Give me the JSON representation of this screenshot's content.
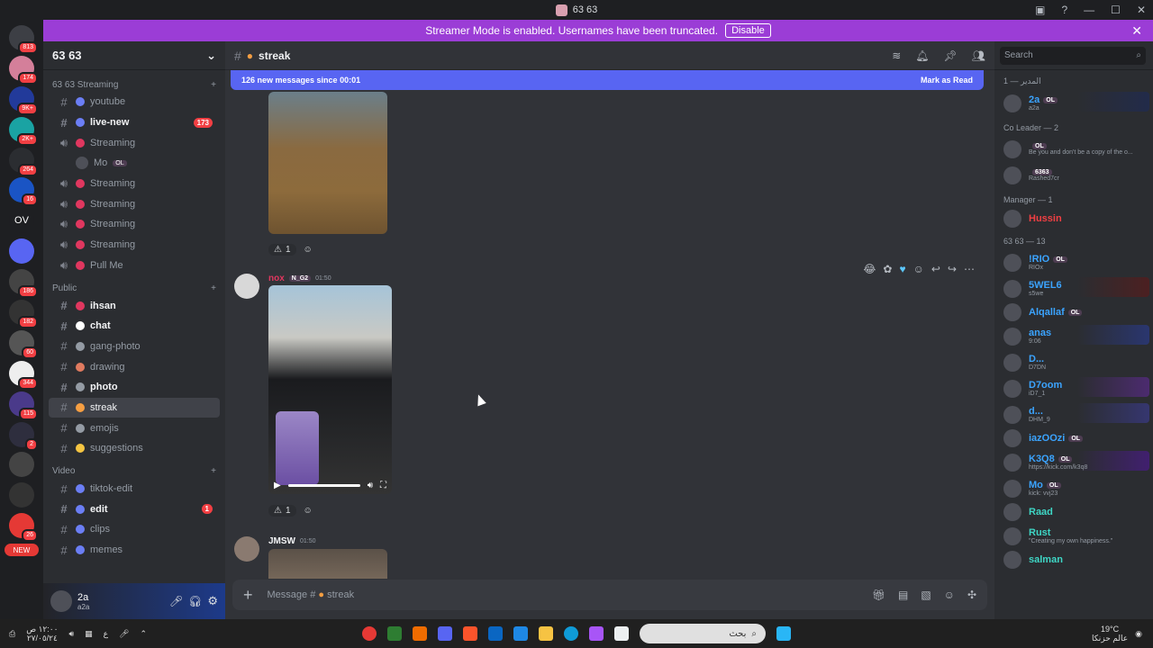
{
  "window": {
    "title": "63 63"
  },
  "banner": {
    "text": "Streamer Mode is enabled. Usernames have been truncated.",
    "disable_label": "Disable"
  },
  "servers": [
    {
      "label": "",
      "badge": "813"
    },
    {
      "label": "",
      "badge": "174"
    },
    {
      "label": "",
      "badge": "9K+"
    },
    {
      "label": "",
      "badge": "2K+"
    },
    {
      "label": "",
      "badge": "264"
    },
    {
      "label": "",
      "badge": "16"
    },
    {
      "label": "OV",
      "badge": ""
    },
    {
      "label": "",
      "badge": ""
    },
    {
      "label": "",
      "badge": "186"
    },
    {
      "label": "",
      "badge": "182"
    },
    {
      "label": "",
      "badge": "60"
    },
    {
      "label": "",
      "badge": "344"
    },
    {
      "label": "",
      "badge": "115"
    },
    {
      "label": "",
      "badge": "2"
    },
    {
      "label": "",
      "badge": ""
    },
    {
      "label": "",
      "badge": ""
    },
    {
      "label": "",
      "badge": "26"
    },
    {
      "label": "NEW",
      "badge": ""
    }
  ],
  "sidebar": {
    "guild_name": "63 63",
    "categories": [
      {
        "name": "63 63 Streaming"
      },
      {
        "name": "Public"
      },
      {
        "name": "Video"
      }
    ],
    "streaming_channels": [
      {
        "name": "youtube",
        "kind": "text",
        "unread": false,
        "count": ""
      },
      {
        "name": "live-new",
        "kind": "text",
        "unread": true,
        "count": "173"
      },
      {
        "name": "Streaming",
        "kind": "voice",
        "unread": false,
        "count": ""
      },
      {
        "name": "Streaming",
        "kind": "voice",
        "unread": false,
        "count": ""
      },
      {
        "name": "Streaming",
        "kind": "voice",
        "unread": false,
        "count": ""
      },
      {
        "name": "Streaming",
        "kind": "voice",
        "unread": false,
        "count": ""
      },
      {
        "name": "Streaming",
        "kind": "voice",
        "unread": false,
        "count": ""
      },
      {
        "name": "Pull Me",
        "kind": "voice",
        "unread": false,
        "count": ""
      }
    ],
    "voice_user": {
      "name": "Mo",
      "tag": "OL"
    },
    "public_channels": [
      {
        "name": "ihsan",
        "unread": true,
        "active": false,
        "color": "#e0375f"
      },
      {
        "name": "chat",
        "unread": true,
        "active": false,
        "color": "#ffffff"
      },
      {
        "name": "gang-photo",
        "unread": false,
        "active": false,
        "color": "#949ba4"
      },
      {
        "name": "drawing",
        "unread": false,
        "active": false,
        "color": "#e07a5f"
      },
      {
        "name": "photo",
        "unread": true,
        "active": false,
        "color": "#949ba4"
      },
      {
        "name": "streak",
        "unread": false,
        "active": true,
        "color": "#f59e42"
      },
      {
        "name": "emojis",
        "unread": false,
        "active": false,
        "color": "#949ba4"
      },
      {
        "name": "suggestions",
        "unread": false,
        "active": false,
        "color": "#f5c542"
      }
    ],
    "video_channels": [
      {
        "name": "tiktok-edit",
        "unread": false,
        "count": ""
      },
      {
        "name": "edit",
        "unread": true,
        "count": "1"
      },
      {
        "name": "clips",
        "unread": false,
        "count": ""
      },
      {
        "name": "memes",
        "unread": false,
        "count": ""
      }
    ],
    "user": {
      "name": "2a",
      "status": "a2a"
    }
  },
  "channel": {
    "name": "streak",
    "new_messages": "126 new messages since 00:01",
    "mark_read": "Mark as Read",
    "composer_placeholder": "Message #",
    "composer_channel": "streak"
  },
  "messages": [
    {
      "author": "",
      "reaction_count": "1"
    },
    {
      "author": "nox",
      "tag": "N_G2",
      "time": "01:50",
      "reaction_count": "1"
    },
    {
      "author": "JMSW",
      "time": "01:50"
    }
  ],
  "members": {
    "search_placeholder": "Search",
    "groups": [
      {
        "title": "المدير — 1",
        "members": [
          {
            "name": "2a",
            "sub": "a2a",
            "color": "#3ba4ff",
            "tag": "OL"
          }
        ]
      },
      {
        "title": "Co Leader — 2",
        "members": [
          {
            "name": "",
            "sub": "Be you and don't be a copy of the o...",
            "color": "#ffffff",
            "tag": "OL"
          },
          {
            "name": "",
            "sub": "Rashed7cr",
            "color": "#ffffff",
            "tag": "6363"
          }
        ]
      },
      {
        "title": "Manager — 1",
        "members": [
          {
            "name": "Hussin",
            "sub": "",
            "color": "#f23f43",
            "tag": ""
          }
        ]
      },
      {
        "title": "63 63 — 13",
        "members": [
          {
            "name": "!RIO",
            "sub": "RIOx",
            "color": "#3ba4ff",
            "tag": "OL"
          },
          {
            "name": "5WEL6",
            "sub": "s5we",
            "color": "#3ba4ff",
            "tag": ""
          },
          {
            "name": "Alqallaf",
            "sub": "",
            "color": "#3ba4ff",
            "tag": "OL"
          },
          {
            "name": "anas",
            "sub": "9:06",
            "color": "#3ba4ff",
            "tag": ""
          },
          {
            "name": "D...",
            "sub": "D7DN",
            "color": "#3ba4ff",
            "tag": ""
          },
          {
            "name": "D7oom",
            "sub": "iD7_1",
            "color": "#3ba4ff",
            "tag": ""
          },
          {
            "name": "d...",
            "sub": "DHM_9",
            "color": "#3ba4ff",
            "tag": ""
          },
          {
            "name": "iazOOzi",
            "sub": "",
            "color": "#3ba4ff",
            "tag": "OL"
          },
          {
            "name": "K3Q8",
            "sub": "https://kick.com/k3q8",
            "color": "#3ba4ff",
            "tag": "OL"
          },
          {
            "name": "Mo",
            "sub": "kick: vvj23",
            "color": "#3ba4ff",
            "tag": "OL"
          },
          {
            "name": "Raad",
            "sub": "",
            "color": "#3ed6c5",
            "tag": ""
          },
          {
            "name": "Rust",
            "sub": "\"Creating my own happiness.\"",
            "color": "#3ed6c5",
            "tag": ""
          },
          {
            "name": "salman",
            "sub": "",
            "color": "#3ed6c5",
            "tag": ""
          }
        ]
      }
    ]
  },
  "taskbar": {
    "time": "١٢:٠٠ ص",
    "date": "٢٧/٠٥/٢٤",
    "search_label": "بحث",
    "weather": "19°C",
    "weather_text": "عالم حزنكا",
    "lang": "ع"
  }
}
